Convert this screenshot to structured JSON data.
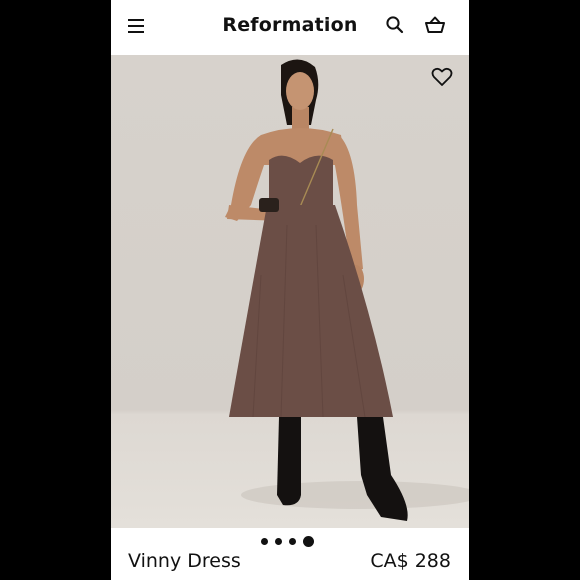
{
  "header": {
    "brand": "Reformation",
    "menu_icon": "menu-icon",
    "search_icon": "search-icon",
    "bag_icon": "shopping-bag-icon"
  },
  "gallery": {
    "favorite_icon": "heart-icon",
    "image_count": 4,
    "active_index": 4
  },
  "product": {
    "name": "Vinny Dress",
    "price": "CA$ 288"
  },
  "colors": {
    "background": "#000000",
    "card": "#ffffff",
    "text": "#111111",
    "dress": "#6b4e46",
    "photo_backdrop": "#d6d1cb"
  }
}
